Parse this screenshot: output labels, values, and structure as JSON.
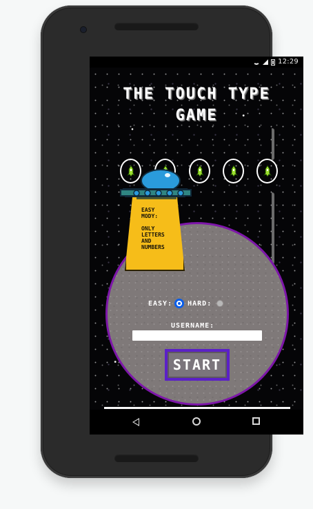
{
  "status": {
    "time": "12:29"
  },
  "game": {
    "title_line1": "THE TOUCH TYPE",
    "title_line2": "GAME",
    "mode_info": "EASY\nMODY:\n\nONLY\nLETTERS\nAND\nNUMBERS",
    "easy_label": "EASY:",
    "hard_label": "HARD:",
    "selected_mode": "easy",
    "username_label": "USERNAME:",
    "username_value": "",
    "start_label": "START"
  },
  "icons": {
    "ufo": "ufo-icon",
    "ships": [
      "rocket-icon",
      "rocket-icon",
      "rocket-icon",
      "rocket-icon",
      "rocket-icon"
    ],
    "back": "back-icon",
    "home": "home-icon",
    "recent": "recent-apps-icon",
    "wifi": "wifi-icon",
    "signal": "signal-icon",
    "battery": "battery-icon"
  },
  "colors": {
    "background": "#050507",
    "title": "#ffffff",
    "beam": "#f6bd19",
    "planet_fill": "#7f7979",
    "planet_border": "#7d16a9",
    "selected_radio": "#0a5eea",
    "start_border": "#5b20c8",
    "rocket": "#9be22c"
  }
}
